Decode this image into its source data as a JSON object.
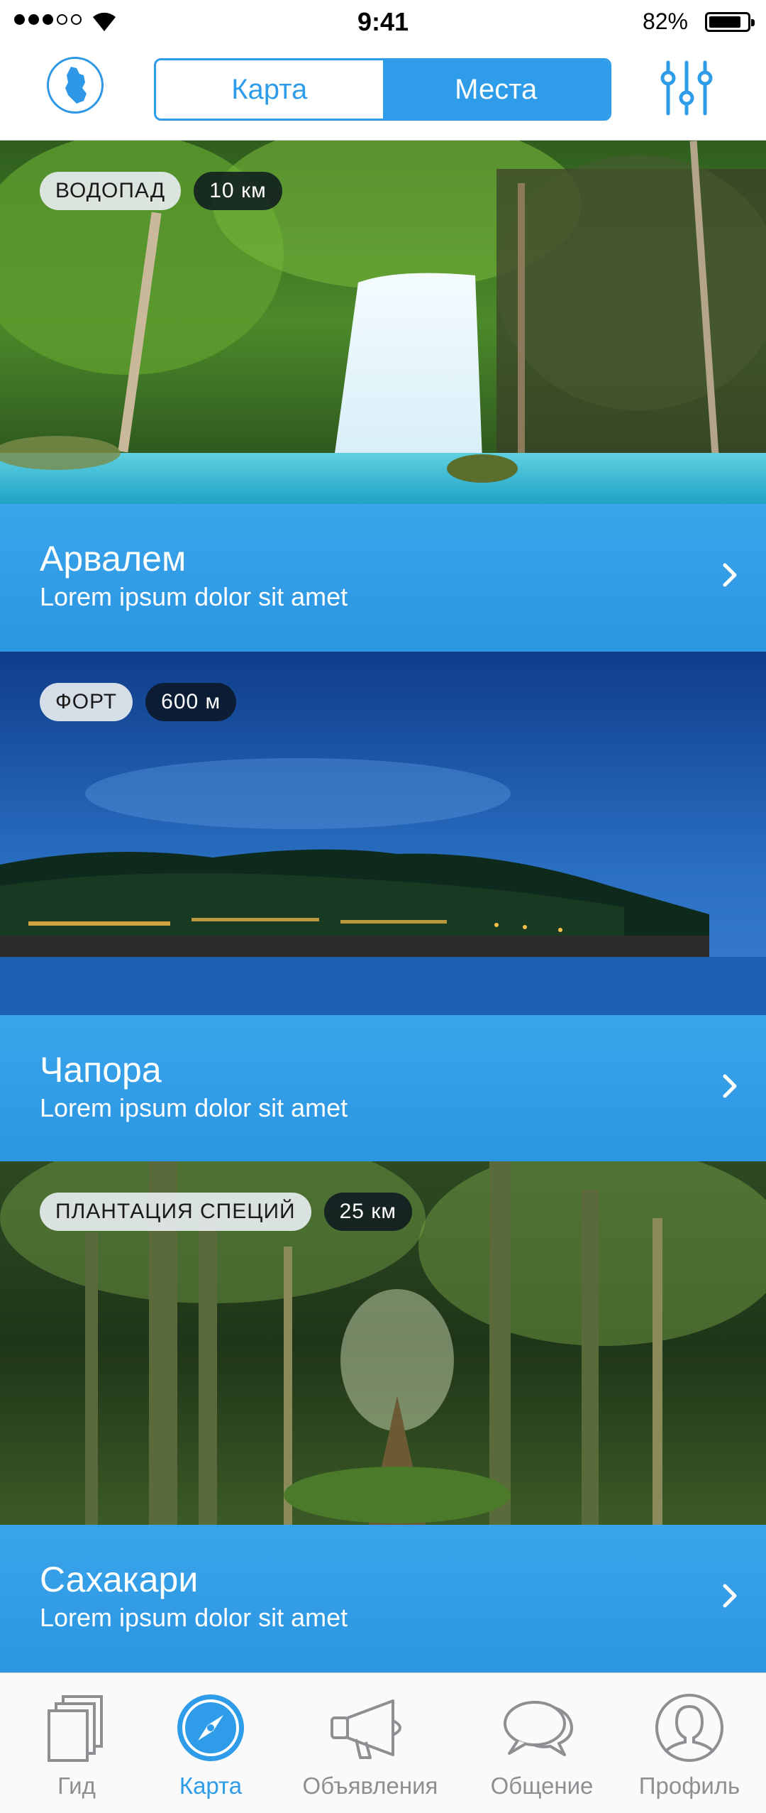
{
  "status": {
    "time": "9:41",
    "battery": "82%"
  },
  "nav": {
    "segments": [
      {
        "label": "Карта",
        "active": false
      },
      {
        "label": "Места",
        "active": true
      }
    ]
  },
  "places": [
    {
      "badge": "ВОДОПАД",
      "distance": "10 км",
      "title": "Арвалем",
      "subtitle": "Lorem ipsum dolor sit amet"
    },
    {
      "badge": "ФОРТ",
      "distance": "600 м",
      "title": "Чапора",
      "subtitle": "Lorem ipsum dolor sit amet"
    },
    {
      "badge": "ПЛАНТАЦИЯ СПЕЦИЙ",
      "distance": "25 км",
      "title": "Сахакари",
      "subtitle": "Lorem ipsum dolor sit amet"
    }
  ],
  "tabs": [
    {
      "label": "Гид",
      "icon": "pages-icon"
    },
    {
      "label": "Карта",
      "icon": "compass-icon",
      "active": true
    },
    {
      "label": "Объявления",
      "icon": "megaphone-icon"
    },
    {
      "label": "Общение",
      "icon": "chat-bubbles-icon"
    },
    {
      "label": "Профиль",
      "icon": "profile-icon"
    }
  ],
  "colors": {
    "accent": "#2e9ce8",
    "band": "#2b96e2",
    "inactive": "#8e8e93"
  }
}
